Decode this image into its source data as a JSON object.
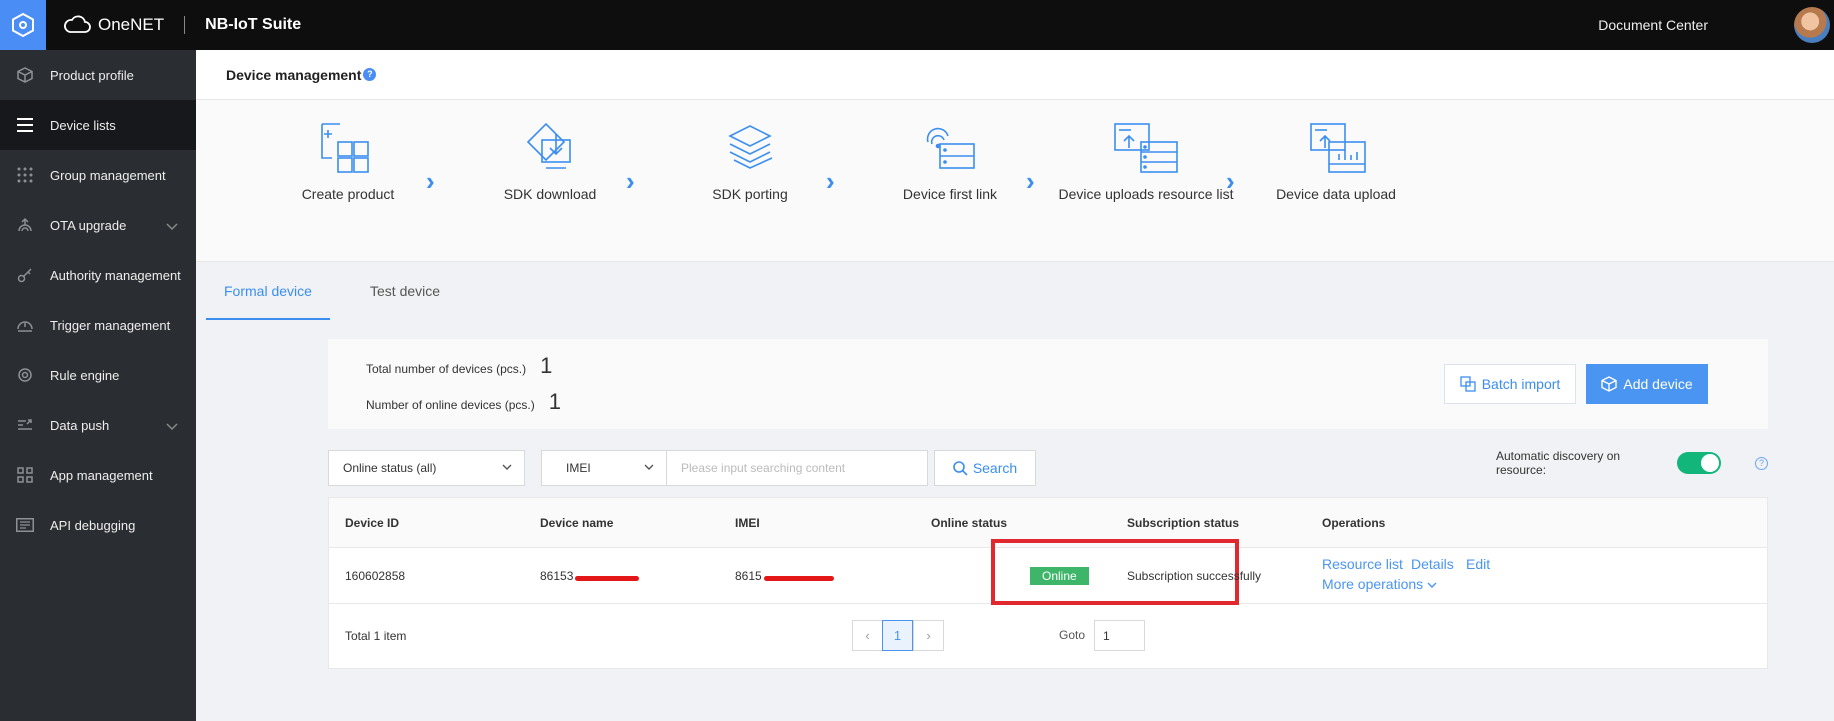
{
  "topbar": {
    "brand": "OneNET",
    "suite": "NB-IoT Suite",
    "doc_center": "Document Center"
  },
  "sidebar": {
    "items": [
      {
        "label": "Product profile",
        "icon": "cube-icon"
      },
      {
        "label": "Device lists",
        "icon": "list-icon",
        "active": true
      },
      {
        "label": "Group management",
        "icon": "grid-dots-icon"
      },
      {
        "label": "OTA upgrade",
        "icon": "ota-icon",
        "expandable": true
      },
      {
        "label": "Authority management",
        "icon": "key-icon"
      },
      {
        "label": "Trigger management",
        "icon": "trigger-icon"
      },
      {
        "label": "Rule engine",
        "icon": "rule-icon"
      },
      {
        "label": "Data push",
        "icon": "push-icon",
        "expandable": true
      },
      {
        "label": "App management",
        "icon": "apps-icon"
      },
      {
        "label": "API debugging",
        "icon": "api-icon"
      }
    ]
  },
  "header": {
    "title": "Device management"
  },
  "steps": [
    {
      "label": "Create product"
    },
    {
      "label": "SDK download"
    },
    {
      "label": "SDK porting"
    },
    {
      "label": "Device first link"
    },
    {
      "label": "Device uploads resource list"
    },
    {
      "label": "Device data upload"
    }
  ],
  "tabs": [
    {
      "label": "Formal device",
      "active": true
    },
    {
      "label": "Test device"
    }
  ],
  "summary": {
    "total_label": "Total number of devices (pcs.)",
    "total_value": "1",
    "online_label": "Number of online devices (pcs.)",
    "online_value": "1",
    "batch_import": "Batch import",
    "add_device": "Add device"
  },
  "filters": {
    "status_select": "Online status (all)",
    "field_select": "IMEI",
    "search_placeholder": "Please input searching content",
    "search_button": "Search",
    "auto_discovery_label": "Automatic discovery on resource:",
    "auto_discovery_on": true
  },
  "table": {
    "columns": [
      "Device ID",
      "Device name",
      "IMEI",
      "Online status",
      "Subscription status",
      "Operations"
    ],
    "rows": [
      {
        "device_id": "160602858",
        "device_name": "86153",
        "imei": "8615",
        "online_status": "Online",
        "subscription": "Subscription successfully",
        "ops": {
          "resource_list": "Resource list",
          "details": "Details",
          "edit": "Edit",
          "more": "More operations"
        }
      }
    ],
    "footer": {
      "total": "Total 1 item",
      "current_page": "1",
      "goto_label": "Goto",
      "goto_value": "1"
    }
  },
  "colors": {
    "accent": "#3b8ef0",
    "online": "#3eb66a",
    "highlight_box": "#e0282e",
    "redaction": "#e31717"
  }
}
